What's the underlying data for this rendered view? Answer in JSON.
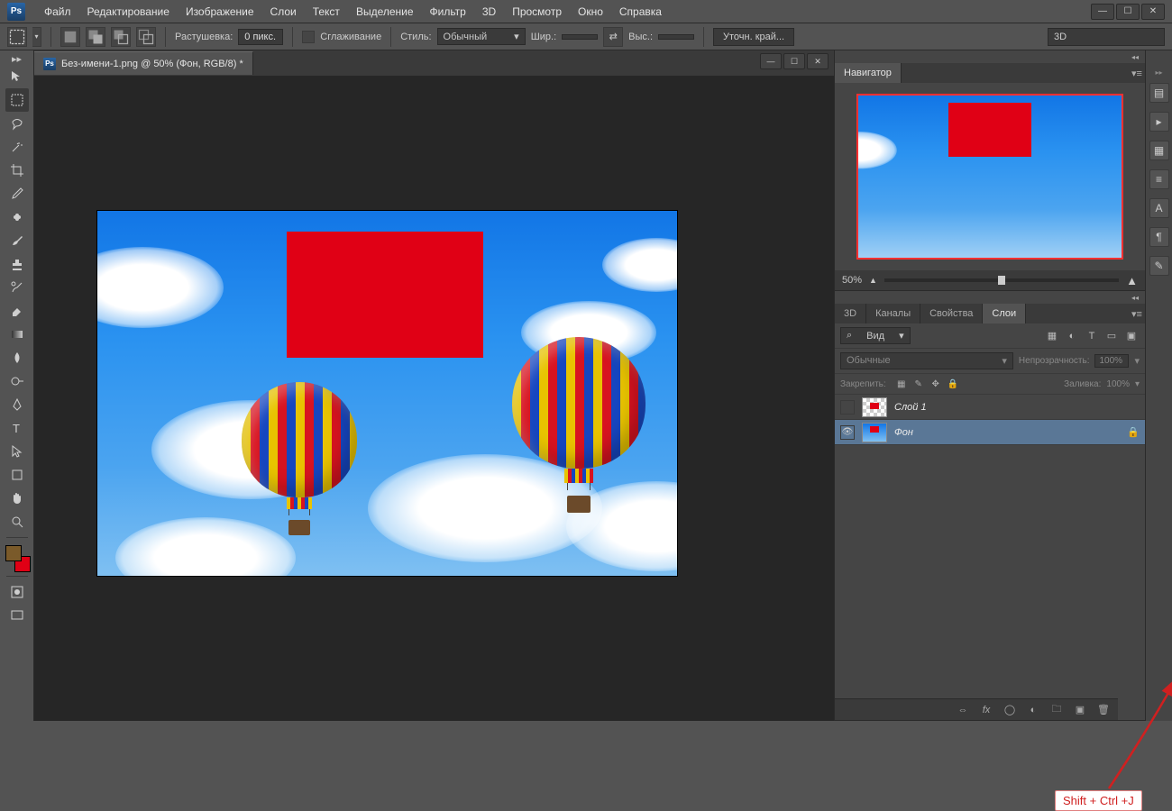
{
  "app": {
    "name": "Ps"
  },
  "menu": {
    "items": [
      "Файл",
      "Редактирование",
      "Изображение",
      "Слои",
      "Текст",
      "Выделение",
      "Фильтр",
      "3D",
      "Просмотр",
      "Окно",
      "Справка"
    ]
  },
  "options": {
    "feather_label": "Растушевка:",
    "feather_value": "0 пикс.",
    "antialias_label": "Сглаживание",
    "style_label": "Стиль:",
    "style_value": "Обычный",
    "width_label": "Шир.:",
    "height_label": "Выс.:",
    "refine_btn": "Уточн. край...",
    "workspace": "3D"
  },
  "document": {
    "tab_title": "Без-имени-1.png @ 50% (Фон, RGB/8) *"
  },
  "navigator": {
    "title": "Навигатор",
    "zoom": "50%"
  },
  "layers_panel": {
    "tabs": {
      "t3d": "3D",
      "channels": "Каналы",
      "props": "Свойства",
      "layers": "Слои"
    },
    "kind_label": "Вид",
    "kind_search_icon": "⌕",
    "blend_mode": "Обычные",
    "opacity_label": "Непрозрачность:",
    "opacity_value": "100%",
    "lock_label": "Закрепить:",
    "fill_label": "Заливка:",
    "fill_value": "100%",
    "layers": [
      {
        "name": "Слой 1",
        "visible": false,
        "locked": false,
        "thumb": "checker",
        "selected": false
      },
      {
        "name": "Фон",
        "visible": true,
        "locked": true,
        "thumb": "img",
        "selected": true
      }
    ]
  },
  "annotation": {
    "text": "Shift + Ctrl +J"
  },
  "colors": {
    "fg": "#7a5a2a",
    "bg": "#e00015",
    "accent_red": "#e00015"
  }
}
